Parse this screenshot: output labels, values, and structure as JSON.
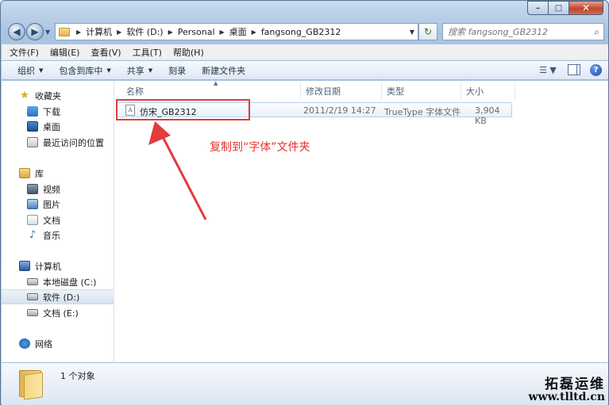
{
  "window": {
    "minimize_label": "–",
    "maximize_label": "□",
    "close_label": "✕"
  },
  "address": {
    "back_glyph": "◀",
    "forward_glyph": "▶",
    "recent_glyph": "▼",
    "crumbs": [
      "计算机",
      "软件 (D:)",
      "Personal",
      "桌面",
      "fangsong_GB2312"
    ],
    "separator": "▶",
    "dropdown_glyph": "▼",
    "refresh_glyph": "↻"
  },
  "search": {
    "placeholder": "搜索 fangsong_GB2312",
    "icon": "magnifier-icon",
    "icon_glyph": "⌕"
  },
  "menu": [
    "文件(F)",
    "编辑(E)",
    "查看(V)",
    "工具(T)",
    "帮助(H)"
  ],
  "toolbar": {
    "organize": "组织",
    "include_in_library": "包含到库中",
    "share": "共享",
    "burn": "刻录",
    "new_folder": "新建文件夹",
    "caret": "▼",
    "views_glyph": "☰ ▼",
    "help_glyph": "?"
  },
  "sidebar": {
    "favorites": {
      "label": "收藏夹",
      "icon_glyph": "★",
      "items": [
        "下载",
        "桌面",
        "最近访问的位置"
      ]
    },
    "libraries": {
      "label": "库",
      "items": [
        "视频",
        "图片",
        "文档",
        "音乐"
      ],
      "music_glyph": "♪"
    },
    "computer": {
      "label": "计算机",
      "items": [
        "本地磁盘 (C:)",
        "软件 (D:)",
        "文档 (E:)"
      ],
      "selected": "软件 (D:)"
    },
    "network": {
      "label": "网络"
    }
  },
  "columns": {
    "name": "名称",
    "date": "修改日期",
    "type": "类型",
    "size": "大小",
    "sort_glyph": "▲"
  },
  "files": [
    {
      "name": "仿宋_GB2312",
      "date": "2011/2/19 14:27",
      "type": "TrueType 字体文件",
      "size": "3,904 KB",
      "icon_glyph": "A"
    }
  ],
  "annotation": {
    "text": "复制到“字体”文件夹",
    "color": "#e5312b"
  },
  "details": {
    "count": "1 个对象"
  },
  "watermark": {
    "name": "拓磊运维",
    "url": "www.tlltd.cn"
  },
  "colors": {
    "accent": "#1f4ea3",
    "annotation_red": "#e23c3c",
    "selection_border": "#b8d0ec"
  }
}
